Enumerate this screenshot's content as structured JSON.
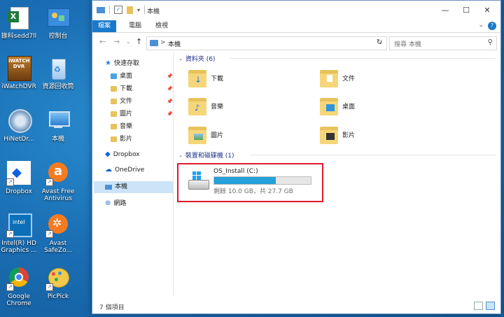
{
  "desktop": {
    "icons": [
      {
        "label": "錄科sedd7ll",
        "icon": "excel-file-icon"
      },
      {
        "label": "控制台",
        "icon": "control-panel-icon"
      },
      {
        "label": "iWatchDVR",
        "icon": "iwatch-dvr-icon"
      },
      {
        "label": "資源回收筒",
        "icon": "recycle-bin-icon"
      },
      {
        "label": "HiNetDr...",
        "icon": "hinet-app-icon"
      },
      {
        "label": "本機",
        "icon": "this-pc-icon"
      },
      {
        "label": "Dropbox",
        "icon": "dropbox-icon"
      },
      {
        "label": "Avast Free Antivirus",
        "icon": "avast-icon"
      },
      {
        "label": "Intel(R) HD Graphics ...",
        "icon": "intel-graphics-icon"
      },
      {
        "label": "Avast SafeZo...",
        "icon": "avast-safezone-icon"
      },
      {
        "label": "Google Chrome",
        "icon": "chrome-icon"
      },
      {
        "label": "PicPick",
        "icon": "picpick-icon"
      }
    ]
  },
  "window": {
    "title": "本機",
    "controls": {
      "minimize": "—",
      "maximize": "☐",
      "close": "✕"
    },
    "ribbon_tabs": [
      "檔案",
      "電腦",
      "檢視"
    ],
    "help": "?",
    "address": {
      "path": "本機",
      "separator": ">"
    },
    "search_placeholder": "搜尋 本機",
    "nav": {
      "quick_access": "快速存取",
      "quick_items": [
        "桌面",
        "下載",
        "文件",
        "圖片",
        "音樂",
        "影片"
      ],
      "dropbox": "Dropbox",
      "onedrive": "OneDrive",
      "this_pc": "本機",
      "network": "網路"
    },
    "groups": {
      "folders_header": "資料夾 (6)",
      "devices_header": "裝置和磁碟機 (1)"
    },
    "folders": [
      "下載",
      "文件",
      "音樂",
      "桌面",
      "圖片",
      "影片"
    ],
    "drive": {
      "name": "OS_Install (C:)",
      "info": "剩餘 10.0 GB，共 27.7 GB",
      "used_fraction": 0.639
    },
    "status": "7 個項目"
  },
  "colors": {
    "accent": "#1979ca",
    "highlight": "#e0192f",
    "drive_fill": "#26a0da",
    "group_header": "#1e3287"
  }
}
